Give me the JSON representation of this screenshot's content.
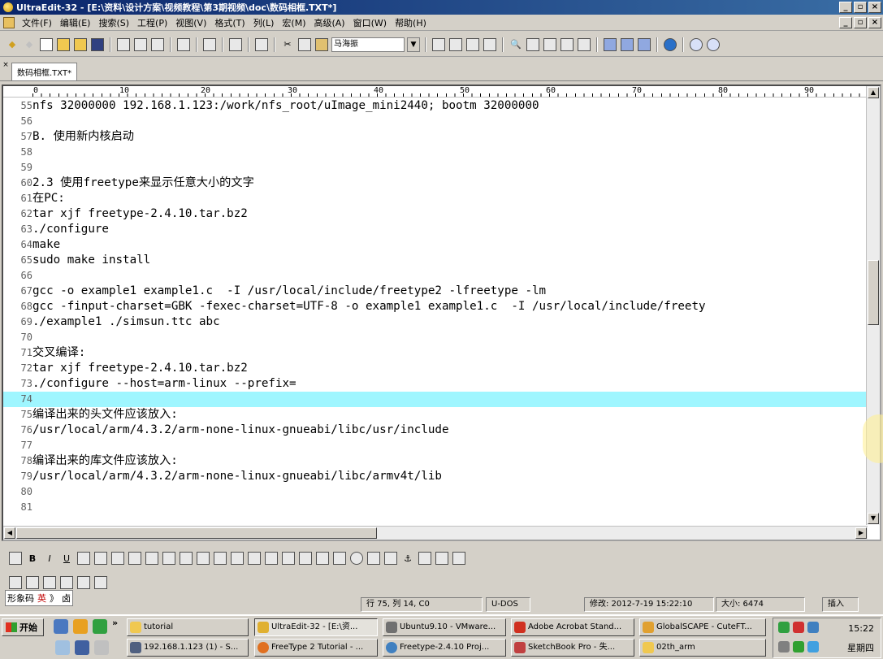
{
  "window": {
    "title": "UltraEdit-32 - [E:\\资料\\设计方案\\视频教程\\第3期视频\\doc\\数码相框.TXT*]",
    "min_label": "_",
    "max_label": "▫",
    "close_label": "×"
  },
  "menu": {
    "items": [
      "文件(F)",
      "编辑(E)",
      "搜索(S)",
      "工程(P)",
      "视图(V)",
      "格式(T)",
      "列(L)",
      "宏(M)",
      "高级(A)",
      "窗口(W)",
      "帮助(H)"
    ]
  },
  "toolbar": {
    "font_name": "马海振",
    "font_dropdown": "▼"
  },
  "tabs": {
    "close": "×",
    "active": "数码相框.TXT*"
  },
  "ruler": {
    "marks": [
      "0",
      "10",
      "20",
      "30",
      "40",
      "50",
      "60",
      "70",
      "80",
      "90"
    ]
  },
  "editor": {
    "lines": [
      {
        "n": "55",
        "t": "nfs 32000000 192.168.1.123:/work/nfs_root/uImage_mini2440; bootm 32000000"
      },
      {
        "n": "56",
        "t": ""
      },
      {
        "n": "57",
        "t": "B. 使用新内核启动"
      },
      {
        "n": "58",
        "t": ""
      },
      {
        "n": "59",
        "t": ""
      },
      {
        "n": "60",
        "t": "2.3 使用freetype来显示任意大小的文字"
      },
      {
        "n": "61",
        "t": "在PC:"
      },
      {
        "n": "62",
        "t": "tar xjf freetype-2.4.10.tar.bz2"
      },
      {
        "n": "63",
        "t": "./configure"
      },
      {
        "n": "64",
        "t": "make"
      },
      {
        "n": "65",
        "t": "sudo make install"
      },
      {
        "n": "66",
        "t": ""
      },
      {
        "n": "67",
        "t": "gcc -o example1 example1.c  -I /usr/local/include/freetype2 -lfreetype -lm"
      },
      {
        "n": "68",
        "t": "gcc -finput-charset=GBK -fexec-charset=UTF-8 -o example1 example1.c  -I /usr/local/include/freety"
      },
      {
        "n": "69",
        "t": "./example1 ./simsun.ttc abc"
      },
      {
        "n": "70",
        "t": ""
      },
      {
        "n": "71",
        "t": "交叉编译:"
      },
      {
        "n": "72",
        "t": "tar xjf freetype-2.4.10.tar.bz2"
      },
      {
        "n": "73",
        "t": "./configure --host=arm-linux --prefix="
      },
      {
        "n": "74",
        "t": ""
      },
      {
        "n": "75",
        "t": "编译出来的头文件应该放入:"
      },
      {
        "n": "76",
        "t": "/usr/local/arm/4.3.2/arm-none-linux-gnueabi/libc/usr/include"
      },
      {
        "n": "77",
        "t": ""
      },
      {
        "n": "78",
        "t": "编译出来的库文件应该放入:"
      },
      {
        "n": "79",
        "t": "/usr/local/arm/4.3.2/arm-none-linux-gnueabi/libc/armv4t/lib"
      },
      {
        "n": "80",
        "t": ""
      },
      {
        "n": "81",
        "t": ""
      }
    ],
    "current_line": 74
  },
  "status": {
    "position": "行 75, 列 14, C0",
    "format": "U-DOS",
    "modified": "修改: 2012-7-19 15:22:10",
    "size": "大小: 6474",
    "mode": "插入",
    "ime": [
      "形象码",
      "英",
      "》",
      "卤"
    ]
  },
  "taskbar": {
    "start_label": "开始",
    "more": "»",
    "tasks_row1": [
      "tutorial",
      "UltraEdit-32 - [E:\\资...",
      "Ubuntu9.10 - VMware...",
      "Adobe Acrobat Stand...",
      "GlobalSCAPE - CuteFT..."
    ],
    "tasks_row2": [
      "192.168.1.123 (1) - S...",
      "FreeType 2 Tutorial - ...",
      "Freetype-2.4.10 Proj...",
      "SketchBook Pro - 失...",
      "02th_arm"
    ],
    "clock": "15:22",
    "day": "星期四"
  }
}
